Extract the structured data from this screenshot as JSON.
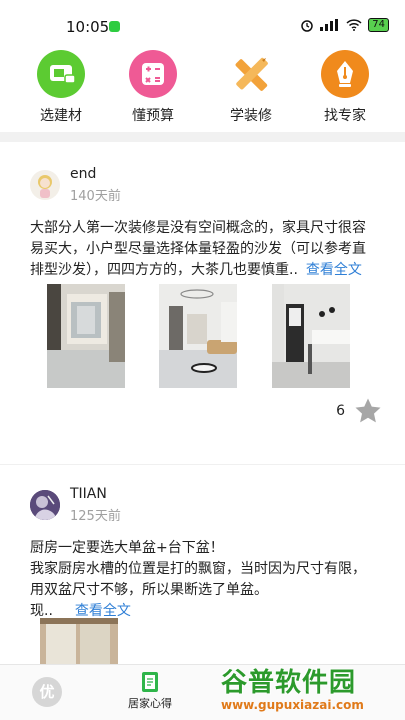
{
  "status": {
    "time": "10:05",
    "battery": "74"
  },
  "quicknav": [
    {
      "label": "选建材",
      "color": "#5ccb32"
    },
    {
      "label": "懂预算",
      "color": "#ef5a95"
    },
    {
      "label": "学装修",
      "color": "#f2a23a"
    },
    {
      "label": "找专家",
      "color": "#f08a1c"
    }
  ],
  "posts": [
    {
      "author": "end",
      "days": "140天前",
      "text": "大部分人第一次装修是没有空间概念的，家具尺寸很容易买大，小户型尽量选择体量轻盈的沙发（可以参考直排型沙发），四四方方的，大茶几也要慎重..",
      "more": "查看全文",
      "likes": "6"
    },
    {
      "author": "TIIAN",
      "days": "125天前",
      "text_lines": [
        "厨房一定要选大单盆+台下盆！",
        "我家厨房水槽的位置是打的飘窗，当时因为尺寸有限，",
        "用双盆尺寸不够，所以果断选了单盆。",
        "现.."
      ],
      "more": "查看全文"
    }
  ],
  "tabbar": {
    "home_icon_text": "优",
    "home_label": "",
    "note_label": "居家心得"
  },
  "watermark": {
    "title": "谷普软件园",
    "url": "www.gupuxiazai.com"
  }
}
